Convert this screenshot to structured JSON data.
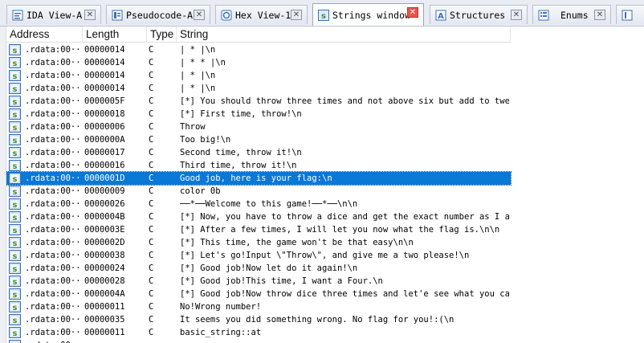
{
  "tabs": [
    {
      "label": "IDA View-A",
      "icon": "ida-view-icon",
      "active": false
    },
    {
      "label": "Pseudocode-A",
      "icon": "pseudocode-icon",
      "active": false
    },
    {
      "label": "Hex View-1",
      "icon": "hex-view-icon",
      "active": false
    },
    {
      "label": "Strings window",
      "icon": "strings-icon",
      "active": true
    },
    {
      "label": "Structures",
      "icon": "structures-icon",
      "active": false
    },
    {
      "label": "Enums",
      "icon": "enums-icon",
      "active": false
    }
  ],
  "tab_close_glyph": "✕",
  "columns": {
    "address": "Address",
    "length": "Length",
    "type": "Type",
    "string": "String"
  },
  "rows": [
    {
      "address": ".rdata:00···",
      "length": "00000014",
      "type": "C",
      "string": "|       *        |\\n"
    },
    {
      "address": ".rdata:00···",
      "length": "00000014",
      "type": "C",
      "string": "| *            * |\\n"
    },
    {
      "address": ".rdata:00···",
      "length": "00000014",
      "type": "C",
      "string": "|              * |\\n"
    },
    {
      "address": ".rdata:00···",
      "length": "00000014",
      "type": "C",
      "string": "| *              |\\n"
    },
    {
      "address": ".rdata:00···",
      "length": "0000005F",
      "type": "C",
      "string": "[*]  You should throw three times and not above six but add to twe···"
    },
    {
      "address": ".rdata:00···",
      "length": "00000018",
      "type": "C",
      "string": "[*]  First time, throw!\\n"
    },
    {
      "address": ".rdata:00···",
      "length": "00000006",
      "type": "C",
      "string": "Throw"
    },
    {
      "address": ".rdata:00···",
      "length": "0000000A",
      "type": "C",
      "string": "Too big!\\n"
    },
    {
      "address": ".rdata:00···",
      "length": "00000017",
      "type": "C",
      "string": "Second time, throw it!\\n"
    },
    {
      "address": ".rdata:00···",
      "length": "00000016",
      "type": "C",
      "string": "Third time, throw it!\\n"
    },
    {
      "address": ".rdata:00···",
      "length": "0000001D",
      "type": "C",
      "string": "Good job, here is your flag:\\n"
    },
    {
      "address": ".rdata:00···",
      "length": "00000009",
      "type": "C",
      "string": "color 0b"
    },
    {
      "address": ".rdata:00···",
      "length": "00000026",
      "type": "C",
      "string": "──*──Welcome to this game!──*──\\n\\n"
    },
    {
      "address": ".rdata:00···",
      "length": "0000004B",
      "type": "C",
      "string": "[*]  Now, you have to throw a dice and get the exact number as I as···"
    },
    {
      "address": ".rdata:00···",
      "length": "0000003E",
      "type": "C",
      "string": "[*]  After a few times, I will let you now what the flag is.\\n\\n"
    },
    {
      "address": ".rdata:00···",
      "length": "0000002D",
      "type": "C",
      "string": "[*]  This time, the game won't be that easy\\n\\n"
    },
    {
      "address": ".rdata:00···",
      "length": "00000038",
      "type": "C",
      "string": "[*]  Let's go!Input \\\"Throw\\\", and give me a two please!\\n"
    },
    {
      "address": ".rdata:00···",
      "length": "00000024",
      "type": "C",
      "string": "[*]  Good job!Now let do it again!\\n"
    },
    {
      "address": ".rdata:00···",
      "length": "00000028",
      "type": "C",
      "string": "[*]  Good job!This time, I want a Four.\\n"
    },
    {
      "address": ".rdata:00···",
      "length": "0000004A",
      "type": "C",
      "string": "[*]  Good job!Now throw dice three times and let'e see what you ca···"
    },
    {
      "address": ".rdata:00···",
      "length": "00000011",
      "type": "C",
      "string": "No!Wrong number!"
    },
    {
      "address": ".rdata:00···",
      "length": "00000035",
      "type": "C",
      "string": "It seems you did something wrong. No flag for you!:(\\n"
    },
    {
      "address": ".rdata:00···",
      "length": "00000011",
      "type": "C",
      "string": "basic_string::at"
    },
    {
      "address": ".rdata:00···",
      "length": "",
      "type": "",
      "string": ""
    }
  ],
  "selected_row": 10,
  "colors": {
    "selection": "#0a78d7",
    "string_icon_green": "#4a8a2a",
    "string_icon_bg": "#dcecff"
  }
}
